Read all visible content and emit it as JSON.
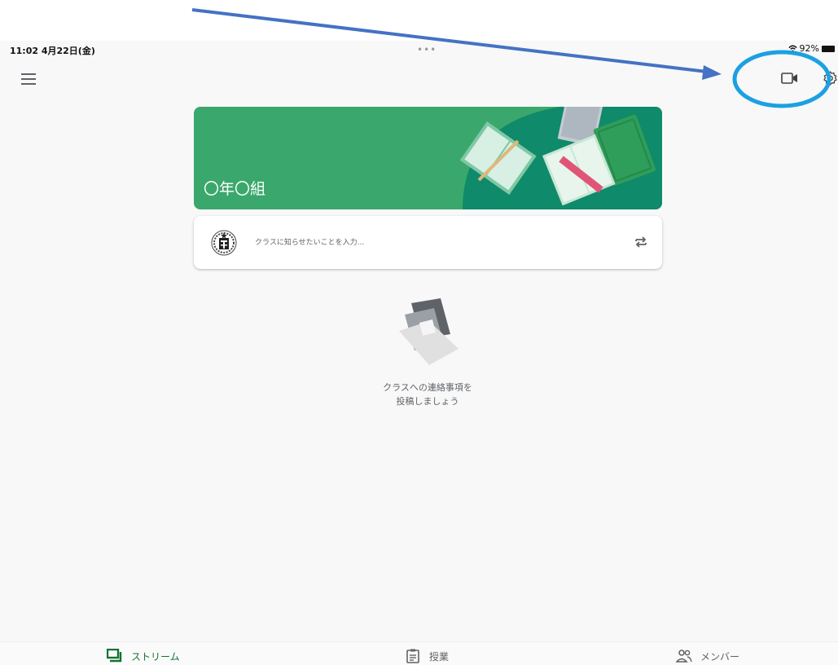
{
  "status_bar": {
    "time": "11:02  4月22日(金)",
    "dots": "•••",
    "battery": "92%"
  },
  "app_bar": {
    "menu_icon": "menu-icon",
    "video_icon": "video-camera-icon",
    "settings_icon": "settings-icon"
  },
  "banner": {
    "class_title": "〇年〇組",
    "background_color": "#3aa86c"
  },
  "announce": {
    "placeholder": "クラスに知らせたいことを入力..."
  },
  "empty_state": {
    "line1": "クラスへの連絡事項を",
    "line2": "投稿しましょう"
  },
  "bottom_nav": {
    "items": [
      {
        "label": "ストリーム",
        "icon": "stream-icon",
        "active": true
      },
      {
        "label": "授業",
        "icon": "classwork-icon",
        "active": false
      },
      {
        "label": "メンバー",
        "icon": "people-icon",
        "active": false
      }
    ]
  },
  "colors": {
    "accent": "#137333",
    "annotation_arrow": "#4472c4",
    "annotation_circle": "#1ba1e2"
  }
}
